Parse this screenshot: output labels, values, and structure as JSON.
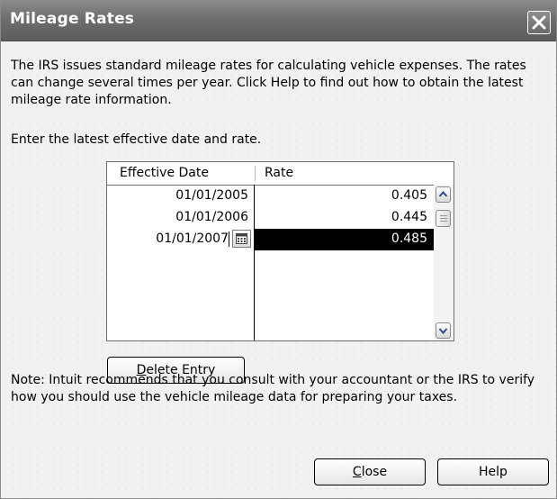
{
  "window": {
    "title": "Mileage Rates"
  },
  "dialog": {
    "intro": "The IRS issues standard mileage rates for calculating vehicle expenses.  The rates can change several times per year.  Click Help to find out how to obtain the latest mileage rate information.",
    "instruction": "Enter the latest effective date and rate.",
    "note": "Note: Intuit recommends that you consult with your accountant or the IRS to verify how you should use the vehicle mileage data for preparing your taxes."
  },
  "table": {
    "columns": [
      "Effective Date",
      "Rate"
    ],
    "rows": [
      {
        "date": "01/01/2005",
        "rate": "0.405"
      },
      {
        "date": "01/01/2006",
        "rate": "0.445"
      },
      {
        "date": "01/01/2007",
        "rate": "0.485"
      }
    ],
    "selected_row": 2
  },
  "buttons": {
    "delete": {
      "access_key": "D",
      "rest": "elete Entry"
    },
    "close": {
      "access_key": "C",
      "rest": "lose"
    },
    "help": "Help"
  },
  "icons": [
    "close-icon",
    "calendar-icon",
    "scroll-up-icon",
    "scroll-down-icon"
  ]
}
